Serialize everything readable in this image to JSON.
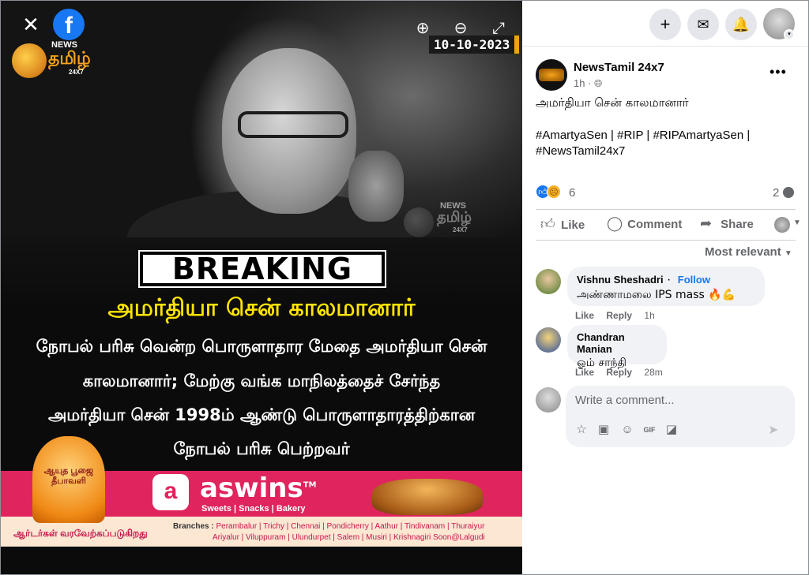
{
  "viewer": {
    "close_icon": "close-icon",
    "fb_logo": "f",
    "brand": {
      "news": "NEWS",
      "tamil": "தமிழ்",
      "suffix": "24X7"
    },
    "date_stamp": "10-10-2023",
    "poster": {
      "breaking": "BREAKING",
      "headline": "அமர்தியா சென் காலமானார்",
      "body": [
        "நோபல் பரிசு வென்ற பொருளாதார மேதை அமர்தியா சென்",
        "காலமானார்; மேற்கு வங்க மாநிலத்தைச் சேர்ந்த",
        "அமர்தியா சென் 1998ம் ஆண்டு பொருளாதாரத்திற்கான",
        "நோபல் பரிசு பெற்றவர்"
      ]
    },
    "ad": {
      "pooja": "ஆயுத பூஜை தீபாவளி",
      "brand": "aswins",
      "tm": "TM",
      "tagline": "Sweets | Snacks | Bakery",
      "welcome": "ஆர்டர்கள் வரவேற்கப்படுகிறது",
      "branches_label": "Branches :",
      "branches_line1": "Perambalur | Trichy | Chennai | Pondicherry | Aathur | Tindivanam | Thuraiyur",
      "branches_line2": "Ariyalur | Viluppuram | Ulundurpet | Salem | Musiri | Krishnagiri Soon@Lalgudi"
    }
  },
  "post": {
    "page_name": "NewsTamil 24x7",
    "time": "1h ·",
    "caption": "அமர்தியா சென் காலமானார்",
    "hashtags": [
      "#AmartyaSen",
      "#RIP",
      "#RIPAmartyaSen",
      "#NewsTamil24x7"
    ],
    "reaction_count": "6",
    "comment_count": "2",
    "actions": {
      "like": "Like",
      "comment": "Comment",
      "share": "Share"
    },
    "sort_label": "Most relevant"
  },
  "comments": [
    {
      "name": "Vishnu Sheshadri",
      "follow": "Follow",
      "text": "அண்ணாமலை IPS mass 🔥💪",
      "like": "Like",
      "reply": "Reply",
      "time": "1h"
    },
    {
      "name": "Chandran Manian",
      "text": "ஓம் சாந்தி",
      "like": "Like",
      "reply": "Reply",
      "time": "28m"
    }
  ],
  "composer": {
    "placeholder": "Write a comment..."
  }
}
